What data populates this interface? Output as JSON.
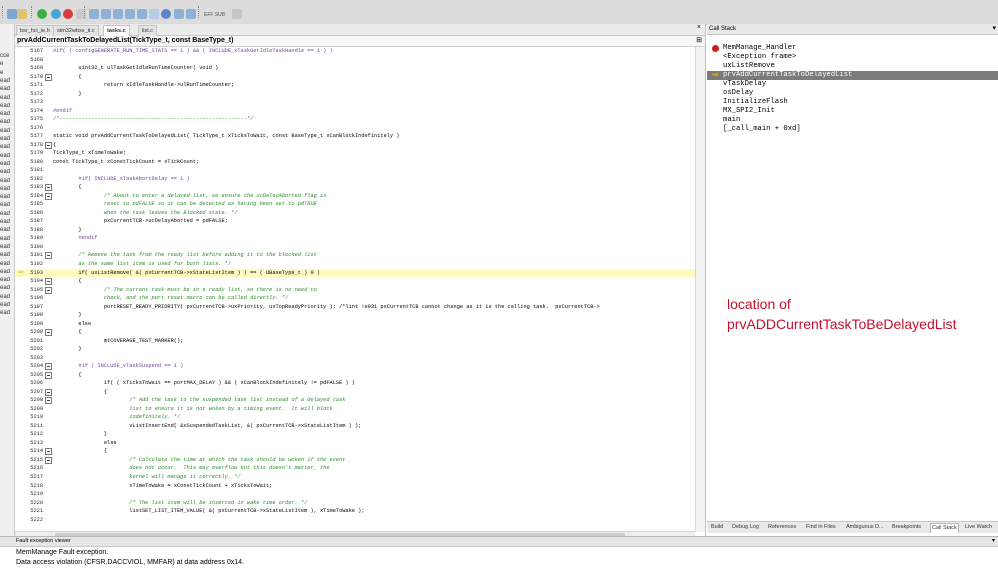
{
  "toolbar": {
    "zoom_label": "EFF SUB"
  },
  "left_strip": {
    "items": [
      "cce",
      "e",
      "e",
      "ead",
      "ead",
      "ead",
      "ead",
      "ead",
      "ead",
      "ead",
      "ead",
      "ead",
      "ead",
      "ead",
      "ead",
      "ead",
      "ead",
      "ead",
      "ead",
      "ead",
      "ead",
      "ead",
      "ead",
      "ead",
      "ead",
      "ead",
      "ead",
      "ead",
      "ead",
      "ead",
      "ead",
      "ead"
    ]
  },
  "editor": {
    "tabs": [
      "bsr_hci_le.h",
      "stm32wbxx_it.c",
      "tasks.c",
      "list.c"
    ],
    "active_tab": "tasks.c",
    "function_bar": "prvAddCurrentTaskToDelayedList(TickType_t, const BaseType_t)",
    "current_line": "5193",
    "lines": [
      {
        "n": "5167",
        "fold": false,
        "t": "#if( ( configGENERATE_RUN_TIME_STATS == 1 ) && ( INCLUDE_xTaskGetIdleTaskHandle == 1 ) )",
        "c": "pp"
      },
      {
        "n": "5168",
        "fold": false,
        "t": ""
      },
      {
        "n": "5169",
        "fold": false,
        "t": "        uint32_t ulTaskGetIdleRunTimeCounter( void )"
      },
      {
        "n": "5170",
        "fold": true,
        "t": "        {"
      },
      {
        "n": "5171",
        "fold": false,
        "t": "                return xIdleTaskHandle->ulRunTimeCounter;"
      },
      {
        "n": "5172",
        "fold": false,
        "t": "        }"
      },
      {
        "n": "5173",
        "fold": false,
        "t": ""
      },
      {
        "n": "5174",
        "fold": false,
        "t": "#endif",
        "c": "pp"
      },
      {
        "n": "5175",
        "fold": false,
        "t": "/*-----------------------------------------------------------*/",
        "c": "cm"
      },
      {
        "n": "5176",
        "fold": false,
        "t": ""
      },
      {
        "n": "5177",
        "fold": false,
        "t": "static void prvAddCurrentTaskToDelayedList( TickType_t xTicksToWait, const BaseType_t xCanBlockIndefinitely )"
      },
      {
        "n": "5178",
        "fold": true,
        "t": "{"
      },
      {
        "n": "5179",
        "fold": false,
        "t": "TickType_t xTimeToWake;"
      },
      {
        "n": "5180",
        "fold": false,
        "t": "const TickType_t xConstTickCount = xTickCount;"
      },
      {
        "n": "5181",
        "fold": false,
        "t": ""
      },
      {
        "n": "5182",
        "fold": false,
        "t": "        #if( INCLUDE_xTaskAbortDelay == 1 )",
        "c": "pp"
      },
      {
        "n": "5183",
        "fold": true,
        "t": "        {"
      },
      {
        "n": "5184",
        "fold": true,
        "t": "                /* About to enter a delayed list, so ensure the ucDelayAborted flag is",
        "c": "cm"
      },
      {
        "n": "5185",
        "fold": false,
        "t": "                reset to pdFALSE so it can be detected as having been set to pdTRUE",
        "c": "cm"
      },
      {
        "n": "5186",
        "fold": false,
        "t": "                when the task leaves the Blocked state. */",
        "c": "cm"
      },
      {
        "n": "5187",
        "fold": false,
        "t": "                pxCurrentTCB->ucDelayAborted = pdFALSE;"
      },
      {
        "n": "5188",
        "fold": false,
        "t": "        }"
      },
      {
        "n": "5189",
        "fold": false,
        "t": "        #endif",
        "c": "pp"
      },
      {
        "n": "5190",
        "fold": false,
        "t": ""
      },
      {
        "n": "5191",
        "fold": true,
        "t": "        /* Remove the task from the ready list before adding it to the blocked list",
        "c": "cm"
      },
      {
        "n": "5192",
        "fold": false,
        "t": "        as the same list item is used for both lists. */",
        "c": "cm"
      },
      {
        "n": "5193",
        "fold": false,
        "t": "        if( uxListRemove( &( pxCurrentTCB->xStateListItem ) ) == ( UBaseType_t ) 0 )",
        "hl": true
      },
      {
        "n": "5194",
        "fold": true,
        "t": "        {"
      },
      {
        "n": "5195",
        "fold": true,
        "t": "                /* The current task must be in a ready list, so there is no need to",
        "c": "cm"
      },
      {
        "n": "5196",
        "fold": false,
        "t": "                check, and the port reset macro can be called directly. */",
        "c": "cm"
      },
      {
        "n": "5197",
        "fold": false,
        "t": "                portRESET_READY_PRIORITY( pxCurrentTCB->uxPriority, uxTopReadyPriority ); /*lint !e931 pxCurrentTCB cannot change as it is the calling task.  pxCurrentTCB->"
      },
      {
        "n": "5198",
        "fold": false,
        "t": "        }"
      },
      {
        "n": "5199",
        "fold": false,
        "t": "        else"
      },
      {
        "n": "5200",
        "fold": true,
        "t": "        {"
      },
      {
        "n": "5201",
        "fold": false,
        "t": "                mtCOVERAGE_TEST_MARKER();"
      },
      {
        "n": "5202",
        "fold": false,
        "t": "        }"
      },
      {
        "n": "5203",
        "fold": false,
        "t": ""
      },
      {
        "n": "5204",
        "fold": true,
        "t": "        #if ( INCLUDE_vTaskSuspend == 1 )",
        "c": "pp"
      },
      {
        "n": "5205",
        "fold": true,
        "t": "        {"
      },
      {
        "n": "5206",
        "fold": false,
        "t": "                if( ( xTicksToWait == portMAX_DELAY ) && ( xCanBlockIndefinitely != pdFALSE ) )"
      },
      {
        "n": "5207",
        "fold": true,
        "t": "                {"
      },
      {
        "n": "5208",
        "fold": true,
        "t": "                        /* Add the task to the suspended task list instead of a delayed task",
        "c": "cm"
      },
      {
        "n": "5209",
        "fold": false,
        "t": "                        list to ensure it is not woken by a timing event.  It will block",
        "c": "cm"
      },
      {
        "n": "5210",
        "fold": false,
        "t": "                        indefinitely. */",
        "c": "cm"
      },
      {
        "n": "5211",
        "fold": false,
        "t": "                        vListInsertEnd( &xSuspendedTaskList, &( pxCurrentTCB->xStateListItem ) );"
      },
      {
        "n": "5212",
        "fold": false,
        "t": "                }"
      },
      {
        "n": "5213",
        "fold": false,
        "t": "                else"
      },
      {
        "n": "5214",
        "fold": true,
        "t": "                {"
      },
      {
        "n": "5215",
        "fold": true,
        "t": "                        /* Calculate the time at which the task should be woken if the event",
        "c": "cm"
      },
      {
        "n": "5216",
        "fold": false,
        "t": "                        does not occur.  This may overflow but this doesn't matter, the",
        "c": "cm"
      },
      {
        "n": "5217",
        "fold": false,
        "t": "                        kernel will manage it correctly. */",
        "c": "cm"
      },
      {
        "n": "5218",
        "fold": false,
        "t": "                        xTimeToWake = xConstTickCount + xTicksToWait;"
      },
      {
        "n": "5219",
        "fold": false,
        "t": ""
      },
      {
        "n": "5220",
        "fold": false,
        "t": "                        /* The list item will be inserted in wake time order. */",
        "c": "cm"
      },
      {
        "n": "5221",
        "fold": false,
        "t": "                        listSET_LIST_ITEM_VALUE( &( pxCurrentTCB->xStateListItem ), xTimeToWake );"
      },
      {
        "n": "5222",
        "fold": false,
        "t": ""
      }
    ]
  },
  "call_stack": {
    "title": "Call Stack",
    "items": [
      {
        "label": "MemManage_Handler",
        "marker": "breakpoint"
      },
      {
        "label": "<Exception frame>",
        "marker": ""
      },
      {
        "label": "uxListRemove",
        "marker": ""
      },
      {
        "label": "prvAddCurrentTaskToDelayedList",
        "marker": "current",
        "selected": true
      },
      {
        "label": "vTaskDelay",
        "marker": ""
      },
      {
        "label": "osDelay",
        "marker": ""
      },
      {
        "label": "InitializeFlash",
        "marker": ""
      },
      {
        "label": "MX_SPI2_Init",
        "marker": ""
      },
      {
        "label": "main",
        "marker": ""
      },
      {
        "label": "[_call_main + 0xd]",
        "marker": ""
      }
    ],
    "annotation_line1": "location of",
    "annotation_line2": "prvADDCurrentTaskToBeDelayedList"
  },
  "bottom_tabs": [
    "Build",
    "Debug Log",
    "References",
    "Find in Files",
    "Ambiguous D...",
    "Breakpoints",
    "Call Stack",
    "Live Watch"
  ],
  "bottom_active_tab": "Call Stack",
  "fault_viewer": {
    "title": "Fault exception viewer",
    "line1": "MemManage Fault exception.",
    "line2": "Data access violation (CFSR.DACCVIOL, MMFAR) at data address 0x14."
  },
  "colors": {
    "highlight": "#fffbbf",
    "selection": "#7b7b7b",
    "annotation": "#c3102e",
    "breakpoint": "#d11a1a",
    "comment": "#2c8a2c"
  }
}
